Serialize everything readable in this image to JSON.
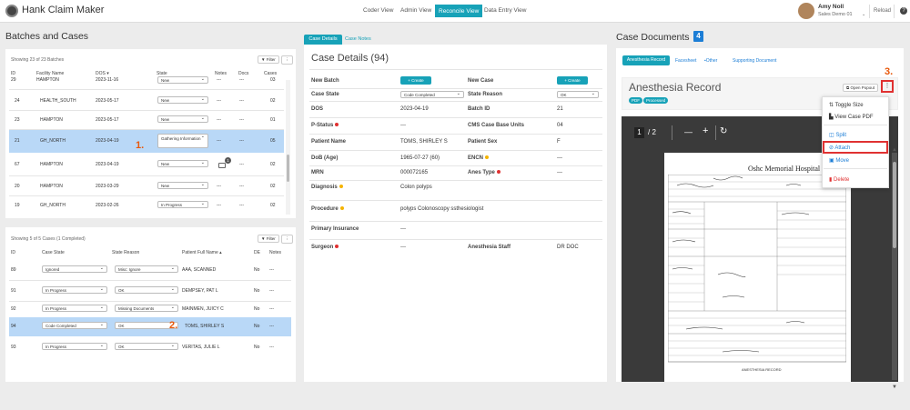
{
  "app": {
    "title": "Hank Claim Maker"
  },
  "nav": {
    "items": [
      "Coder View",
      "Admin View",
      "Reconcile View",
      "Data Entry View"
    ],
    "active": "Reconcile View"
  },
  "user": {
    "name": "Amy Noll",
    "org": "Sales Demo 01",
    "reload": "Reload",
    "help": "?"
  },
  "batches": {
    "title": "Batches and Cases",
    "showing": "Showing 23 of 23 Batches",
    "filter": "Filter",
    "headers": [
      "ID",
      "Facility Name",
      "DOS",
      "State",
      "Notes",
      "Docs",
      "Cases"
    ],
    "rows": [
      {
        "id": "29",
        "facility": "HAMPTON",
        "dos": "2023-11-16",
        "state": "New",
        "notes": "---",
        "docs": "---",
        "cases": "03"
      },
      {
        "id": "24",
        "facility": "HEALTH_SOUTH",
        "dos": "2023-05-17",
        "state": "New",
        "notes": "---",
        "docs": "---",
        "cases": "02"
      },
      {
        "id": "23",
        "facility": "HAMPTON",
        "dos": "2023-05-17",
        "state": "New",
        "notes": "---",
        "docs": "---",
        "cases": "01"
      },
      {
        "id": "21",
        "facility": "GH_NORTH",
        "dos": "2023-04-19",
        "state": "Gathering Information",
        "notes": "---",
        "docs": "---",
        "cases": "05"
      },
      {
        "id": "67",
        "facility": "HAMPTON",
        "dos": "2023-04-19",
        "state": "New",
        "notes": "",
        "docs": "---",
        "cases": "02",
        "badge": "1"
      },
      {
        "id": "20",
        "facility": "HAMPTON",
        "dos": "2023-03-29",
        "state": "New",
        "notes": "---",
        "docs": "---",
        "cases": "02"
      },
      {
        "id": "19",
        "facility": "GH_NORTH",
        "dos": "2023-02-26",
        "state": "In Progress",
        "notes": "---",
        "docs": "---",
        "cases": "02"
      }
    ]
  },
  "cases": {
    "showing": "Showing 5 of 5 Cases (1 Completed)",
    "filter": "Filter",
    "headers": [
      "ID",
      "Case State",
      "State Reason",
      "Patient Full Name",
      "DE",
      "Notes"
    ],
    "rows": [
      {
        "id": "89",
        "state": "Ignored",
        "reason": "Misc: Ignore",
        "patient": "AAA, SCANNED",
        "de": "No",
        "notes": "---"
      },
      {
        "id": "91",
        "state": "In Progress",
        "reason": "OK",
        "patient": "DEMPSEY, PAT L",
        "de": "No",
        "notes": "---"
      },
      {
        "id": "92",
        "state": "In Progress",
        "reason": "Missing Documents",
        "patient": "MAINMEN, JUICY C",
        "de": "No",
        "notes": "---"
      },
      {
        "id": "94",
        "state": "Code Completed",
        "reason": "OK",
        "patient": "TOMS, SHIRLEY S",
        "de": "No",
        "notes": "---"
      },
      {
        "id": "93",
        "state": "In Progress",
        "reason": "OK",
        "patient": "VERITAS, JULIE L",
        "de": "No",
        "notes": "---"
      }
    ]
  },
  "details": {
    "tabs": [
      "Case Details",
      "Case Notes"
    ],
    "title": "Case Details (94)",
    "create": "+ Create",
    "fields": {
      "new_batch": "New Batch",
      "new_case": "New Case",
      "case_state": "Case State",
      "case_state_val": "Code Completed",
      "state_reason": "State Reason",
      "state_reason_val": "OK",
      "dos": "DOS",
      "dos_val": "2023-04-19",
      "batch_id": "Batch ID",
      "batch_id_val": "21",
      "pstatus": "P-Status",
      "pstatus_val": "---",
      "cms": "CMS Case Base Units",
      "cms_val": "04",
      "patient_name": "Patient Name",
      "patient_name_val": "TOMS, SHIRLEY S",
      "patient_sex": "Patient Sex",
      "patient_sex_val": "F",
      "dob": "DoB (Age)",
      "dob_val": "1965-07-27 (60)",
      "encn": "ENCN",
      "encn_val": "---",
      "mrn": "MRN",
      "mrn_val": "000072165",
      "anes_type": "Anes Type",
      "anes_type_val": "---",
      "diagnosis": "Diagnosis",
      "diagnosis_val": "Colon polyps",
      "procedure": "Procedure",
      "procedure_val": "polyps Colonoscopy ssthesiologist",
      "primary_ins": "Primary Insurance",
      "primary_ins_val": "---",
      "surgeon": "Surgeon",
      "surgeon_val": "---",
      "anes_staff": "Anesthesia Staff",
      "anes_staff_val": "DR DOC"
    }
  },
  "documents": {
    "title": "Case Documents",
    "count": "4",
    "tabs": [
      "Anesthesia Record",
      "Facesheet",
      "Other",
      "Supporting Document"
    ],
    "doc_title": "Anesthesia Record",
    "badges": [
      "PDF",
      "Processed"
    ],
    "open_popout": "Open Popout",
    "page_current": "1",
    "page_total": "/ 2",
    "zoom_minus": "—",
    "zoom_plus": "+",
    "form_header": "Oshc Memorial Hospital",
    "form_footer": "ANESTHESIA RECORD",
    "menu": [
      "Toggle Size",
      "View Case PDF",
      "Split",
      "Attach",
      "Move",
      "Delete"
    ]
  },
  "annotations": [
    "1.",
    "2.",
    "3."
  ],
  "colors": {
    "teal": "#17a2b8",
    "highlight": "#b9d8f7",
    "red": "#e03131",
    "orange": "#e8590c"
  }
}
